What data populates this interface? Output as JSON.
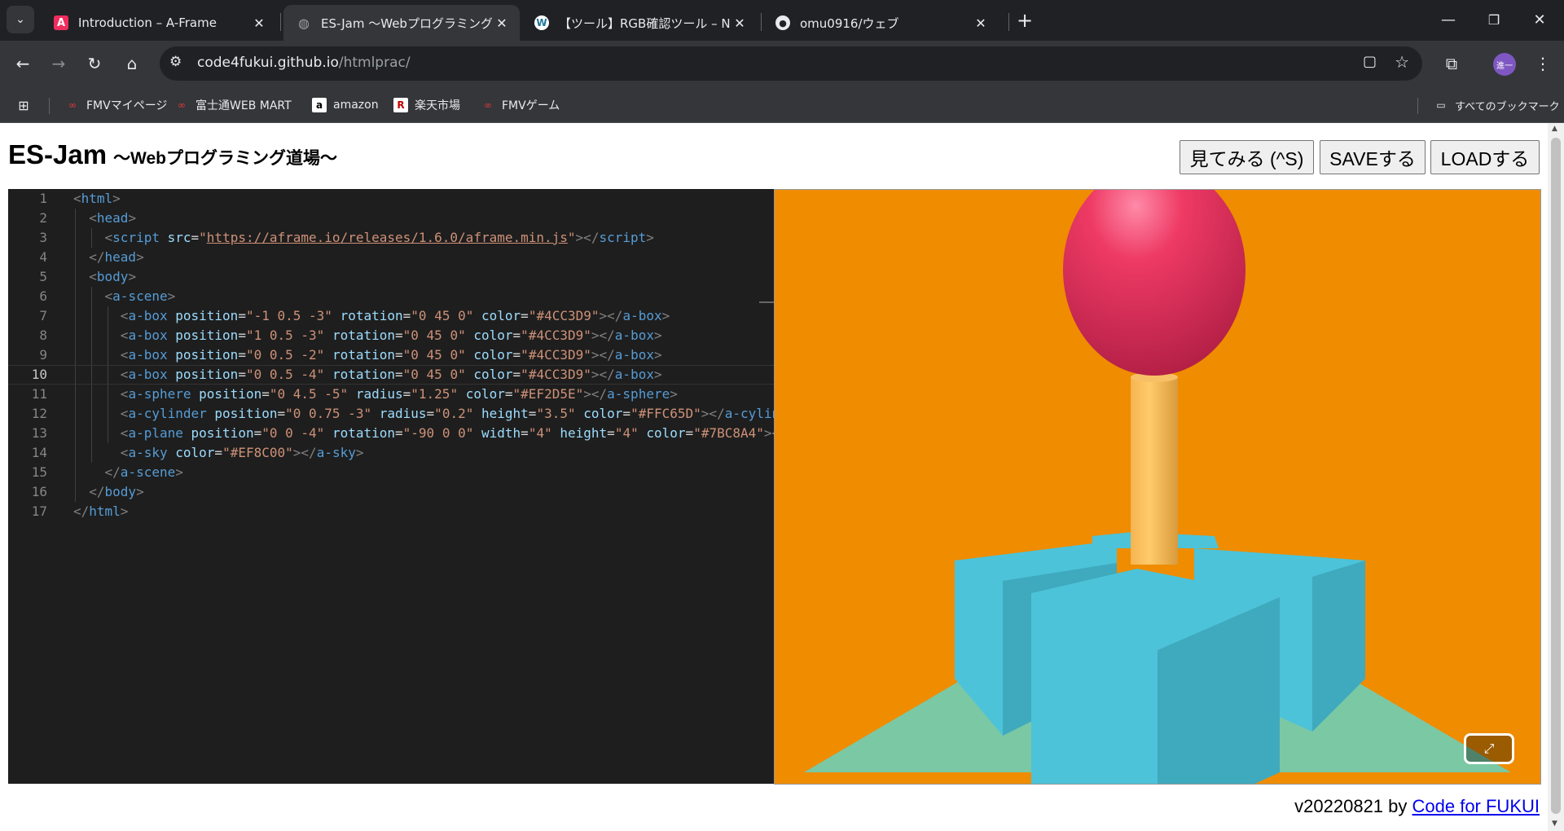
{
  "browser": {
    "tabs": [
      {
        "title": "Introduction – A-Frame",
        "icon": "aframe-icon",
        "active": false
      },
      {
        "title": "ES-Jam 〜Webプログラミング道場〜",
        "icon": "globe-icon",
        "active": true
      },
      {
        "title": "【ツール】RGB確認ツール – NEMOTO",
        "icon": "wordpress-icon",
        "active": false
      },
      {
        "title": "omu0916/ウェブ",
        "icon": "github-icon",
        "active": false
      }
    ],
    "url_host": "code4fukui.github.io",
    "url_path": "/htmlprac/",
    "profile_initials": "進一",
    "bookmarks": [
      {
        "label": "FMVマイページ"
      },
      {
        "label": "富士通WEB MART"
      },
      {
        "label": "amazon"
      },
      {
        "label": "楽天市場"
      },
      {
        "label": "FMVゲーム"
      }
    ],
    "all_bookmarks_label": "すべてのブックマーク"
  },
  "page": {
    "title": "ES-Jam",
    "subtitle": "〜Webプログラミング道場〜",
    "buttons": {
      "view": "見てみる (^S)",
      "save": "SAVEする",
      "load": "LOADする"
    },
    "code_lines": [
      {
        "n": "1"
      },
      {
        "n": "2"
      },
      {
        "n": "3"
      },
      {
        "n": "4"
      },
      {
        "n": "5"
      },
      {
        "n": "6"
      },
      {
        "n": "7"
      },
      {
        "n": "8"
      },
      {
        "n": "9"
      },
      {
        "n": "10"
      },
      {
        "n": "11"
      },
      {
        "n": "12"
      },
      {
        "n": "13"
      },
      {
        "n": "14"
      },
      {
        "n": "15"
      },
      {
        "n": "16"
      },
      {
        "n": "17"
      }
    ],
    "code_text": {
      "l3_src": "https://aframe.io/releases/1.6.0/aframe.min.js",
      "l7": [
        "-1 0.5 -3",
        "0 45 0",
        "#4CC3D9"
      ],
      "l8": [
        "1 0.5 -3",
        "0 45 0",
        "#4CC3D9"
      ],
      "l9": [
        "0 0.5 -2",
        "0 45 0",
        "#4CC3D9"
      ],
      "l10": [
        "0 0.5 -4",
        "0 45 0",
        "#4CC3D9"
      ],
      "l11": [
        "0 4.5 -5",
        "1.25",
        "#EF2D5E"
      ],
      "l12": [
        "0 0.75 -3",
        "0.2",
        "3.5",
        "#FFC65D"
      ],
      "l13": [
        "0 0 -4",
        "-90 0 0",
        "4",
        "4",
        "#7BC8A4"
      ],
      "l14": [
        "#EF8C00"
      ]
    },
    "footer_version": "v20220821 by ",
    "footer_link": "Code for FUKUI",
    "colors": {
      "sky": "#EF8C00",
      "box": "#4CC3D9",
      "sphere": "#EF2D5E",
      "cylinder": "#FFC65D",
      "plane": "#7BC8A4"
    }
  }
}
